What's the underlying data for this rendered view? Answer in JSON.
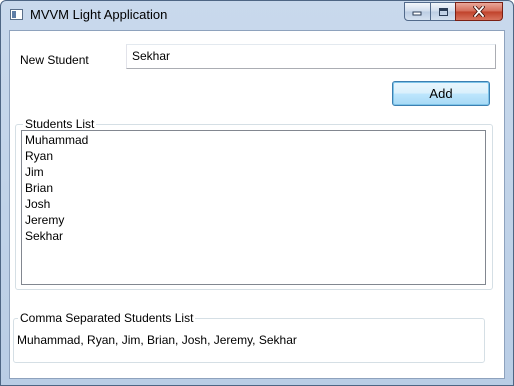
{
  "window": {
    "title": "MVVM Light Application",
    "icons": {
      "app": "app-window-icon",
      "minimize": "minimize-icon",
      "maximize": "maximize-icon",
      "close": "close-icon"
    }
  },
  "form": {
    "new_student_label": "New Student",
    "new_student_value": "Sekhar",
    "add_button_label": "Add"
  },
  "students_group": {
    "header": "Students List",
    "items": [
      "Muhammad",
      "Ryan",
      "Jim",
      "Brian",
      "Josh",
      "Jeremy",
      "Sekhar"
    ]
  },
  "comma_group": {
    "header": "Comma Separated Students List",
    "text": "Muhammad, Ryan, Jim, Brian, Josh, Jeremy, Sekhar"
  }
}
